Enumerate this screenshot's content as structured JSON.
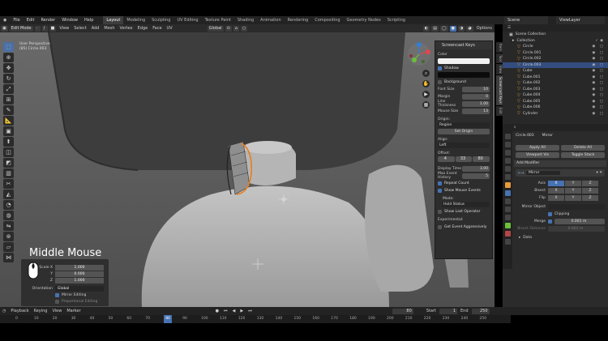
{
  "top_menu": {
    "items": [
      "File",
      "Edit",
      "Render",
      "Window",
      "Help"
    ],
    "workspaces": [
      "Layout",
      "Modeling",
      "Sculpting",
      "UV Editing",
      "Texture Paint",
      "Shading",
      "Animation",
      "Rendering",
      "Compositing",
      "Geometry Nodes",
      "Scripting"
    ],
    "active_workspace": "Layout",
    "scene_label": "Scene",
    "view_layer_label": "ViewLayer"
  },
  "viewport_header": {
    "mode": "Edit Mode",
    "menus": [
      "View",
      "Select",
      "Add",
      "Mesh",
      "Vertex",
      "Edge",
      "Face",
      "UV"
    ],
    "transform_orientation": "Global",
    "options_label": "Options"
  },
  "viewport": {
    "info_line1": "User Perspective",
    "info_line2": "(85) Circle.003"
  },
  "screencast_panel": {
    "title": "Screencast Keys",
    "color_label": "Color",
    "shadow_label": "Shadow",
    "background_label": "Background",
    "font_size_label": "Font Size",
    "font_size": "10",
    "margin_label": "Margin",
    "margin": "0",
    "line_thickness_label": "Line Thickness",
    "line_thickness": "1.00",
    "mouse_size_label": "Mouse Size",
    "mouse_size": "13",
    "origin_label": "Origin:",
    "origin_value": "Region",
    "set_origin": "Set Origin",
    "align_label": "Align:",
    "align_value": "Left",
    "offset_label": "Offset:",
    "offset_x": "4",
    "offset_y": "33",
    "offset_z": "80",
    "display_time_label": "Display Time",
    "display_time": "3.00",
    "max_history_label": "Max Event History",
    "max_history": "5",
    "repeat_count": "Repeat Count",
    "show_mouse": "Show Mouse Events",
    "mode_label": "Mode:",
    "mode_value": "Hold Status",
    "show_last_op": "Show Last Operator",
    "experimental_label": "Experimental:",
    "get_event": "Get Event Aggressively"
  },
  "side_tabs": [
    "Item",
    "Tool",
    "View",
    "Screencast Keys",
    "Edit"
  ],
  "overlay": {
    "mouse_text": "Middle Mouse"
  },
  "operator_panel": {
    "scale_x_label": "Scale X",
    "scale_x": "1.000",
    "y_label": "Y",
    "y": "0.000",
    "z_label": "Z",
    "z": "1.000",
    "orientation_label": "Orientation",
    "orientation": "Global",
    "mirror_editing": "Mirror Editing",
    "proportional_editing": "Proportional Editing"
  },
  "outliner": {
    "header": "Scene Collection",
    "collection": "Collection",
    "items": [
      {
        "name": "Circle",
        "selected": false
      },
      {
        "name": "Circle.001",
        "selected": false
      },
      {
        "name": "Circle.002",
        "selected": false
      },
      {
        "name": "Circle.003",
        "selected": true
      },
      {
        "name": "Cube",
        "selected": false
      },
      {
        "name": "Cube.001",
        "selected": false
      },
      {
        "name": "Cube.002",
        "selected": false
      },
      {
        "name": "Cube.003",
        "selected": false
      },
      {
        "name": "Cube.004",
        "selected": false
      },
      {
        "name": "Cube.005",
        "selected": false
      },
      {
        "name": "Cube.006",
        "selected": false
      },
      {
        "name": "Cylinder",
        "selected": false
      }
    ]
  },
  "properties": {
    "object_name": "Circle.003",
    "modifier_name": "Mirror",
    "apply_all": "Apply All",
    "delete_all": "Delete All",
    "viewport_vis": "Viewport Vis",
    "toggle_stack": "Toggle Stack",
    "add_modifier": "Add Modifier",
    "mirror_label": "Mirror",
    "axis_label": "Axis",
    "bisect_label": "Bisect",
    "flip_label": "Flip",
    "axes": [
      "X",
      "Y",
      "Z"
    ],
    "mirror_object_label": "Mirror Object",
    "clipping_label": "Clipping",
    "merge_label": "Merge",
    "merge_value": "0.001 m",
    "bisect_dist_label": "Bisect Distance",
    "bisect_dist": "0.001 m",
    "data_label": "Data"
  },
  "timeline": {
    "menus": [
      "Playback",
      "Keying",
      "View",
      "Marker"
    ],
    "current_frame": "80",
    "start_label": "Start",
    "start": "1",
    "end_label": "End",
    "end": "250",
    "ticks": [
      "0",
      "10",
      "20",
      "30",
      "40",
      "50",
      "60",
      "70",
      "80",
      "90",
      "100",
      "110",
      "120",
      "130",
      "140",
      "150",
      "160",
      "170",
      "180",
      "190",
      "200",
      "210",
      "220",
      "230",
      "240",
      "250"
    ]
  }
}
